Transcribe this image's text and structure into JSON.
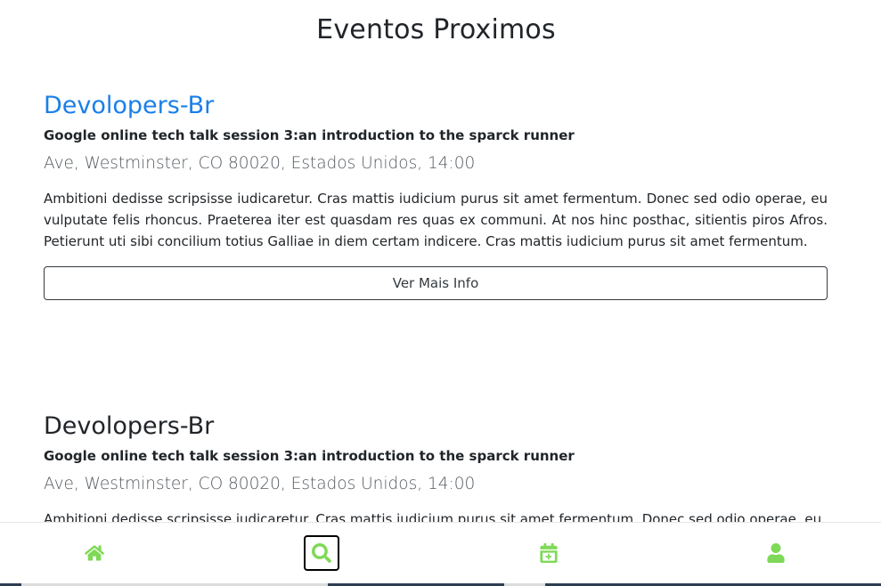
{
  "page": {
    "title": "Eventos Proximos"
  },
  "events": [
    {
      "name": "Devolopers-Br",
      "subtitle": "Google online tech talk session 3:an introduction to the sparck runner",
      "location": "Ave, Westminster, CO 80020, Estados Unidos, 14:00",
      "description": "Ambitioni dedisse scripsisse iudicaretur. Cras mattis iudicium purus sit amet fermentum. Donec sed odio operae, eu vulputate felis rhoncus. Praeterea iter est quasdam res quas ex communi. At nos hinc posthac, sitientis piros Afros. Petierunt uti sibi concilium totius Galliae in diem certam indicere. Cras mattis iudicium purus sit amet fermentum.",
      "button_label": "Ver Mais Info"
    },
    {
      "name": "Devolopers-Br",
      "subtitle": "Google online tech talk session 3:an introduction to the sparck runner",
      "location": "Ave, Westminster, CO 80020, Estados Unidos, 14:00",
      "description": "Ambitioni dedisse scripsisse iudicaretur. Cras mattis iudicium purus sit amet fermentum. Donec sed odio operae, eu"
    }
  ],
  "bottom_nav": {
    "items": [
      {
        "icon": "home-icon",
        "active": false
      },
      {
        "icon": "search-icon",
        "active": true
      },
      {
        "icon": "calendar-plus-icon",
        "active": false
      },
      {
        "icon": "user-icon",
        "active": false
      }
    ],
    "icon_color": "#7ed957"
  },
  "colors": {
    "accent_link": "#1a7fe8",
    "text": "#212529",
    "muted": "#555b61"
  }
}
